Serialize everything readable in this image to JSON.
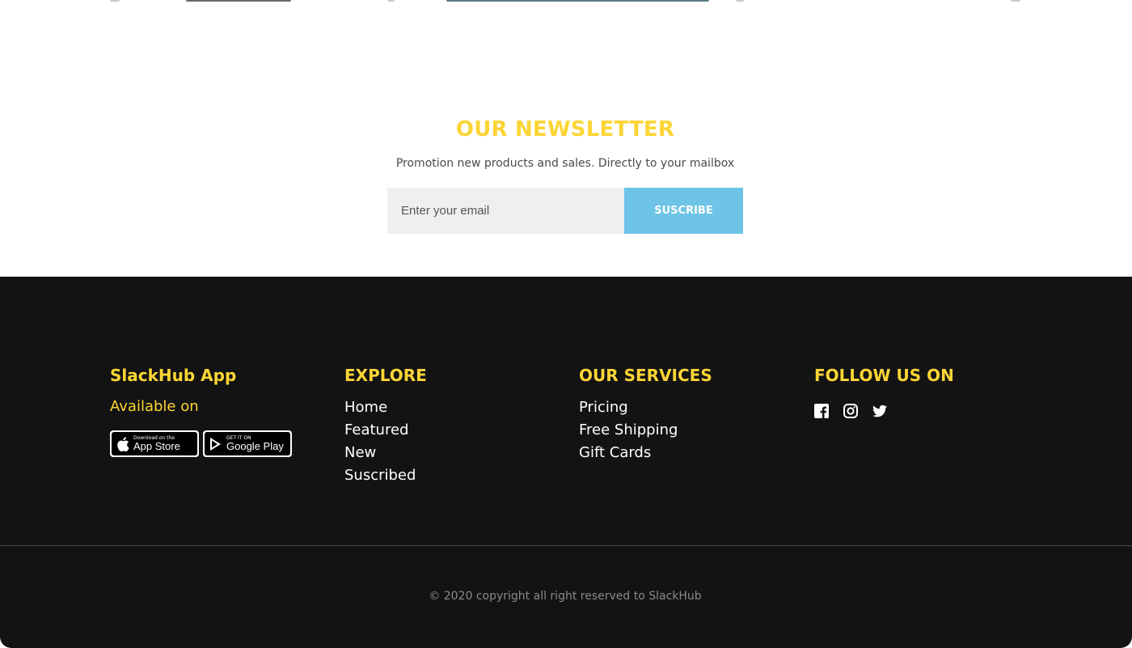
{
  "newsletter": {
    "title": "OUR NEWSLETTER",
    "subtitle": "Promotion new products and sales. Directly to your mailbox",
    "email_placeholder": "Enter your email",
    "button_label": "SUSCRIBE",
    "accent_color": "#fcd535",
    "button_color": "#6ec4e6"
  },
  "footer": {
    "app": {
      "title": "SlackHub App",
      "available_label": "Available on",
      "app_store": {
        "small": "Download on the",
        "big": "App Store",
        "icon": "apple-icon"
      },
      "google_play": {
        "small": "GET IT ON",
        "big": "Google Play",
        "icon": "play-icon"
      }
    },
    "explore": {
      "title": "EXPLORE",
      "links": [
        "Home",
        "Featured",
        "New",
        "Suscribed"
      ]
    },
    "services": {
      "title": "OUR SERVICES",
      "links": [
        "Pricing",
        "Free Shipping",
        "Gift Cards"
      ]
    },
    "follow": {
      "title": "FOLLOW US ON",
      "icons": [
        "facebook-icon",
        "instagram-icon",
        "twitter-icon"
      ]
    },
    "copyright": "© 2020 copyright all right reserved to SlackHub",
    "background_color": "#131313"
  }
}
